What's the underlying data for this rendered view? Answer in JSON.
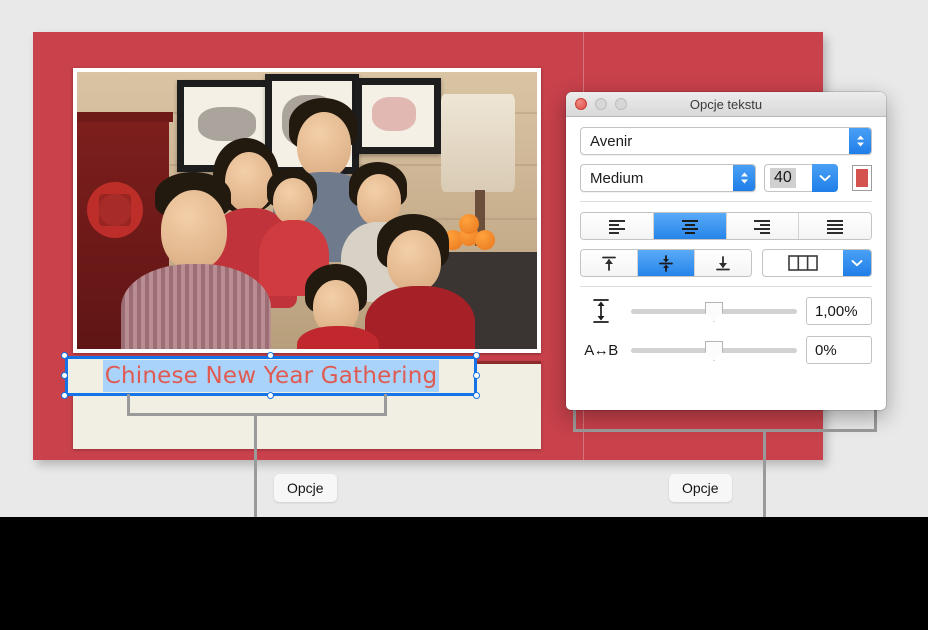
{
  "card": {
    "accent_color": "#c8414b",
    "caption_bg": "#f1eee4",
    "caption": {
      "text": "Chinese New Year Gathering",
      "text_color": "#df5b52",
      "selection_color": "#aad3fb"
    },
    "photo_alt": "Family portrait at Chinese New Year gathering"
  },
  "callouts": [
    {
      "label": "Opcje"
    },
    {
      "label": "Opcje"
    }
  ],
  "window": {
    "title": "Opcje tekstu",
    "traffic": {
      "close": "close-button",
      "minimize": "minimize-button",
      "zoom": "zoom-button"
    },
    "font": {
      "family": "Avenir",
      "weight": "Medium",
      "size": "40",
      "color": "#d4534e"
    },
    "align": {
      "options": [
        "align-left",
        "align-center",
        "align-right",
        "align-justify"
      ],
      "selected": 1
    },
    "valign": {
      "options": [
        "align-top",
        "align-middle",
        "align-bottom"
      ],
      "selected": 1
    },
    "columns": {
      "icon": "columns-icon"
    },
    "sliders": [
      {
        "icon": "line-spacing-icon",
        "value": "1,00%",
        "position": 50
      },
      {
        "icon": "character-spacing-icon",
        "label": "A↔B",
        "value": "0%",
        "position": 50
      }
    ]
  }
}
